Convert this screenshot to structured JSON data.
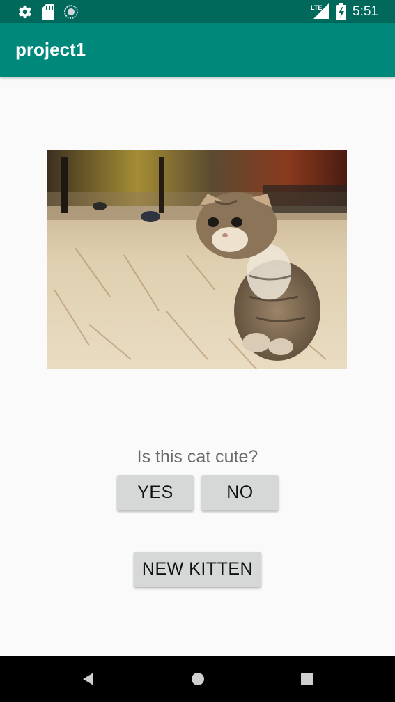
{
  "status_bar": {
    "time": "5:51",
    "network": "LTE",
    "icons": [
      "settings-icon",
      "sd-card-icon",
      "sync-icon",
      "signal-icon",
      "battery-icon"
    ],
    "background": "#00695c"
  },
  "app_bar": {
    "title": "project1",
    "background": "#00897b"
  },
  "main": {
    "image_alt": "kitten",
    "question": "Is this cat cute?",
    "yes_label": "YES",
    "no_label": "NO",
    "new_kitten_label": "NEW KITTEN"
  },
  "nav_bar": {
    "icons": [
      "back-icon",
      "home-icon",
      "recents-icon"
    ]
  }
}
